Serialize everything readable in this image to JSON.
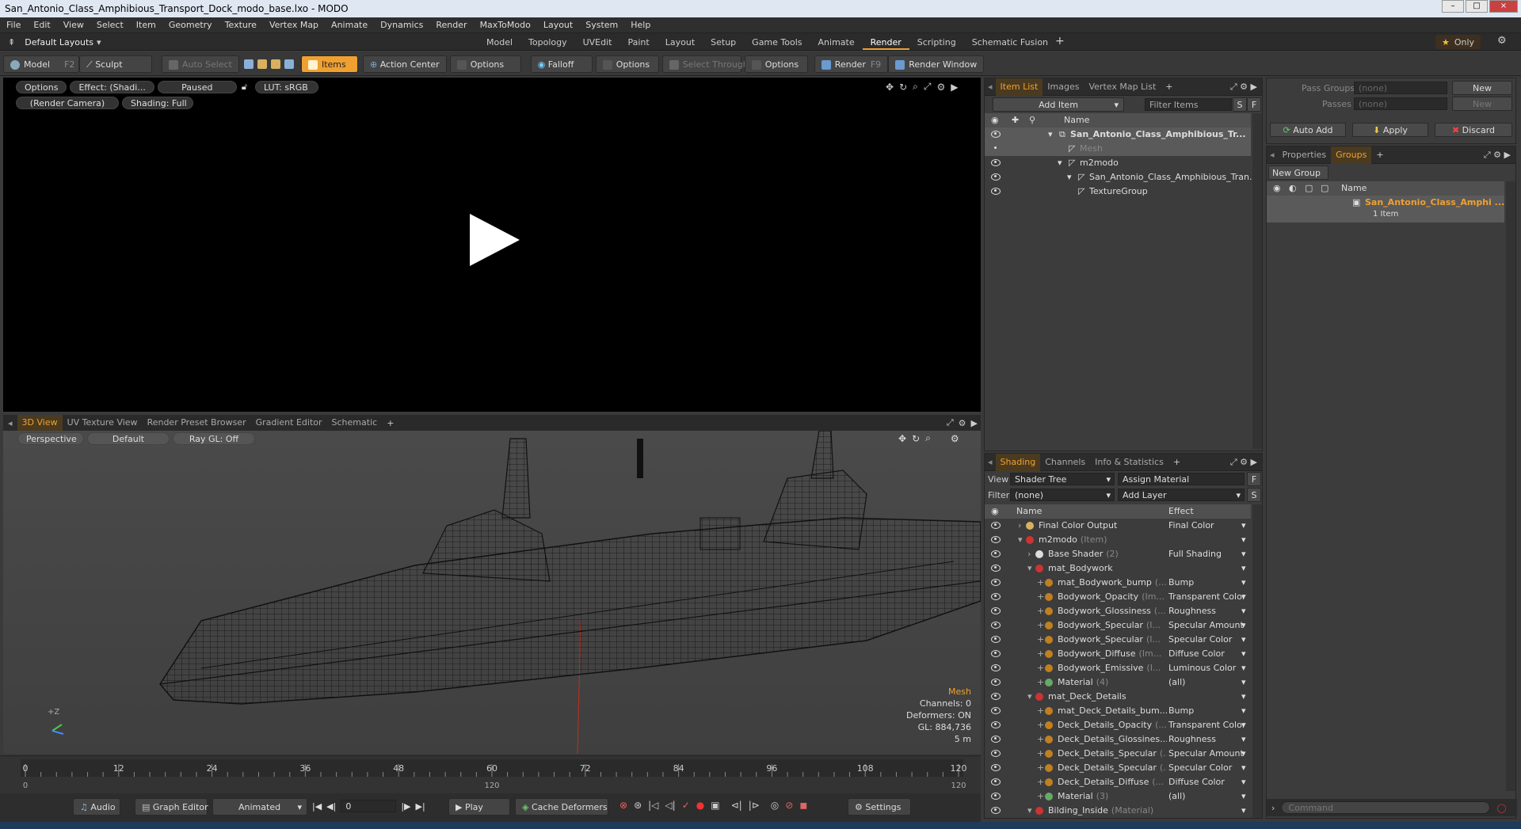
{
  "window": {
    "title": "San_Antonio_Class_Amphibious_Transport_Dock_modo_base.lxo - MODO"
  },
  "menu": [
    "File",
    "Edit",
    "View",
    "Select",
    "Item",
    "Geometry",
    "Texture",
    "Vertex Map",
    "Animate",
    "Dynamics",
    "Render",
    "MaxToModo",
    "Layout",
    "System",
    "Help"
  ],
  "layout_selector": "Default Layouts",
  "layout_tabs": [
    "Model",
    "Topology",
    "UVEdit",
    "Paint",
    "Layout",
    "Setup",
    "Game Tools",
    "Animate",
    "Render",
    "Scripting",
    "Schematic Fusion"
  ],
  "active_layout_tab": "Render",
  "only_label": "Only",
  "toolbar": {
    "model": "Model",
    "model_key": "F2",
    "sculpt": "Sculpt",
    "auto_select": "Auto Select",
    "items": "Items",
    "action_center": "Action Center",
    "options1": "Options",
    "falloff": "Falloff",
    "options2": "Options",
    "select_through": "Select Through",
    "options3": "Options",
    "render": "Render",
    "render_key": "F9",
    "render_window": "Render Window"
  },
  "render_view": {
    "options": "Options",
    "effect": "Effect: (Shadi...",
    "paused": "Paused",
    "lut": "LUT: sRGB",
    "camera": "(Render Camera)",
    "shading": "Shading: Full"
  },
  "view_tabs": [
    "3D View",
    "UV Texture View",
    "Render Preset Browser",
    "Gradient Editor",
    "Schematic"
  ],
  "view3d": {
    "perspective": "Perspective",
    "default": "Default",
    "raygl": "Ray GL: Off",
    "info_title": "Mesh",
    "channels": "Channels: 0",
    "deformers": "Deformers: ON",
    "gl": "GL: 884,736",
    "scale": "5 m",
    "axis_label": "+Z"
  },
  "timeline": {
    "ticks": [
      "0",
      "12",
      "24",
      "36",
      "48",
      "60",
      "72",
      "84",
      "96",
      "108",
      "120"
    ],
    "sub_ticks": [
      "0",
      "120",
      "120"
    ]
  },
  "bottom": {
    "audio": "Audio",
    "graph_editor": "Graph Editor",
    "animated": "Animated",
    "frame": "0",
    "play": "Play",
    "cache_deformers": "Cache Deformers",
    "settings": "Settings"
  },
  "item_list": {
    "tabs": [
      "Item List",
      "Images",
      "Vertex Map List"
    ],
    "add_item": "Add Item",
    "filter_items": "Filter Items",
    "s": "S",
    "f": "F",
    "col_name": "Name",
    "rows": [
      {
        "label": "San_Antonio_Class_Amphibious_Tr...",
        "indent": 0,
        "bold": true
      },
      {
        "label": "Mesh",
        "indent": 1,
        "dim": true
      },
      {
        "label": "m2modo",
        "indent": 1
      },
      {
        "label": "San_Antonio_Class_Amphibious_Tran...",
        "indent": 2
      },
      {
        "label": "TextureGroup",
        "indent": 2
      }
    ]
  },
  "pass_panel": {
    "pass_groups": "Pass Groups",
    "passes": "Passes",
    "none1": "(none)",
    "none2": "(none)",
    "new1": "New",
    "new2": "New",
    "auto_add": "Auto Add",
    "apply": "Apply",
    "discard": "Discard"
  },
  "groups_panel": {
    "tabs": [
      "Properties",
      "Groups"
    ],
    "new_group": "New Group",
    "col_name": "Name",
    "group_name": "San_Antonio_Class_Amphi ...",
    "group_count": "1 Item"
  },
  "shading": {
    "tabs": [
      "Shading",
      "Channels",
      "Info & Statistics"
    ],
    "view_label": "View",
    "view_value": "Shader Tree",
    "assign_material": "Assign Material",
    "filter_label": "Filter",
    "filter_value": "(none)",
    "add_layer": "Add Layer",
    "col_name": "Name",
    "col_effect": "Effect",
    "rows": [
      {
        "name": "Final Color Output",
        "suffix": "",
        "effect": "Final Color",
        "indent": 1,
        "color": "#d8b060"
      },
      {
        "name": "m2modo",
        "suffix": "(Item)",
        "effect": "",
        "indent": 1,
        "color": "#cc3333"
      },
      {
        "name": "Base Shader",
        "suffix": "(2)",
        "effect": "Full Shading",
        "indent": 2,
        "color": "#dddddd"
      },
      {
        "name": "mat_Bodywork",
        "suffix": "",
        "effect": "",
        "indent": 2,
        "color": "#cc3333"
      },
      {
        "name": "mat_Bodywork_bump",
        "suffix": "(...",
        "effect": "Bump",
        "indent": 3,
        "color": "#c08020"
      },
      {
        "name": "Bodywork_Opacity",
        "suffix": "(Im...",
        "effect": "Transparent Color",
        "indent": 3,
        "color": "#c08020"
      },
      {
        "name": "Bodywork_Glossiness",
        "suffix": "(...",
        "effect": "Roughness",
        "indent": 3,
        "color": "#c08020"
      },
      {
        "name": "Bodywork_Specular",
        "suffix": "(I...",
        "effect": "Specular Amount",
        "indent": 3,
        "color": "#c08020"
      },
      {
        "name": "Bodywork_Specular",
        "suffix": "(I...",
        "effect": "Specular Color",
        "indent": 3,
        "color": "#c08020"
      },
      {
        "name": "Bodywork_Diffuse",
        "suffix": "(Im...",
        "effect": "Diffuse Color",
        "indent": 3,
        "color": "#c08020"
      },
      {
        "name": "Bodywork_Emissive",
        "suffix": "(I...",
        "effect": "Luminous Color",
        "indent": 3,
        "color": "#c08020"
      },
      {
        "name": "Material",
        "suffix": "(4)",
        "effect": "(all)",
        "indent": 3,
        "color": "#66aa66"
      },
      {
        "name": "mat_Deck_Details",
        "suffix": "",
        "effect": "",
        "indent": 2,
        "color": "#cc3333"
      },
      {
        "name": "mat_Deck_Details_bum...",
        "suffix": "",
        "effect": "Bump",
        "indent": 3,
        "color": "#c08020"
      },
      {
        "name": "Deck_Details_Opacity",
        "suffix": "(...",
        "effect": "Transparent Color",
        "indent": 3,
        "color": "#c08020"
      },
      {
        "name": "Deck_Details_Glossines...",
        "suffix": "",
        "effect": "Roughness",
        "indent": 3,
        "color": "#c08020"
      },
      {
        "name": "Deck_Details_Specular",
        "suffix": "(...",
        "effect": "Specular Amount",
        "indent": 3,
        "color": "#c08020"
      },
      {
        "name": "Deck_Details_Specular",
        "suffix": "(...",
        "effect": "Specular Color",
        "indent": 3,
        "color": "#c08020"
      },
      {
        "name": "Deck_Details_Diffuse",
        "suffix": "(...",
        "effect": "Diffuse Color",
        "indent": 3,
        "color": "#c08020"
      },
      {
        "name": "Material",
        "suffix": "(3)",
        "effect": "(all)",
        "indent": 3,
        "color": "#66aa66"
      },
      {
        "name": "Bilding_Inside",
        "suffix": "(Material)",
        "effect": "",
        "indent": 2,
        "color": "#cc3333"
      }
    ]
  },
  "command": {
    "placeholder": "Command"
  },
  "colors": {
    "accent": "#f0a030",
    "panel": "#3c3c3c",
    "viewport": "#000000"
  }
}
